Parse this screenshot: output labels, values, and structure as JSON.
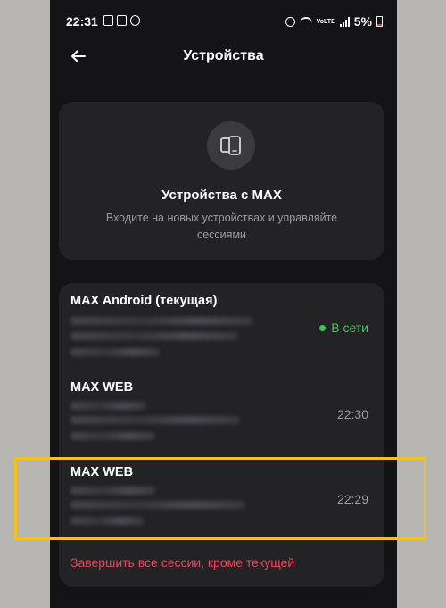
{
  "status_bar": {
    "time": "22:31",
    "network_label": "VoLTE",
    "battery": "5%"
  },
  "header": {
    "title": "Устройства",
    "back_icon": "arrow-left-icon"
  },
  "hero": {
    "icon": "devices-icon",
    "title": "Устройства с MAX",
    "subtitle": "Входите на новых устройствах и управляйте сессиями"
  },
  "sessions": [
    {
      "name": "MAX Android (текущая)",
      "status": "В сети",
      "online": true
    },
    {
      "name": "MAX WEB",
      "status": "22:30",
      "online": false
    },
    {
      "name": "MAX WEB",
      "status": "22:29",
      "online": false
    }
  ],
  "actions": {
    "terminate_others": "Завершить все сессии, кроме текущей"
  },
  "colors": {
    "accent_online": "#3ec45a",
    "danger": "#e8455e",
    "highlight": "#f2c21b"
  }
}
